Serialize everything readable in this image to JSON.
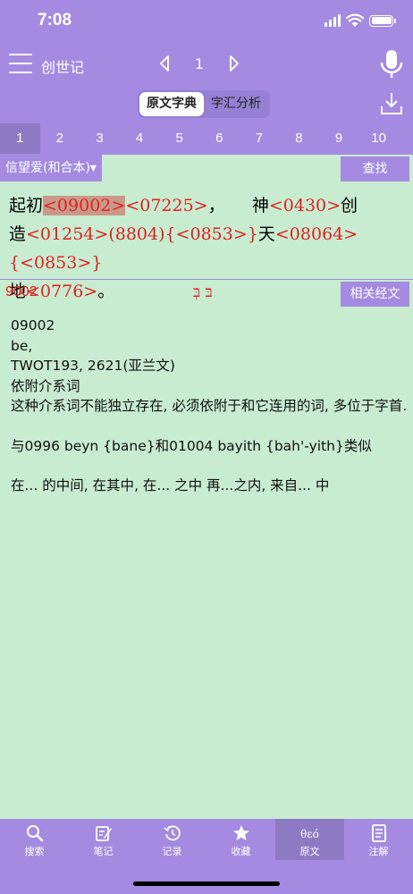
{
  "status": {
    "time": "7:08"
  },
  "nav": {
    "book": "创世记",
    "chapter": "1"
  },
  "segments": [
    {
      "label": "原文字典",
      "active": true
    },
    {
      "label": "字汇分析",
      "active": false
    }
  ],
  "verse_tabs": [
    "1",
    "2",
    "3",
    "4",
    "5",
    "6",
    "7",
    "8",
    "9",
    "10"
  ],
  "version": {
    "label": "信望爱(和合本)▾",
    "search_label": "查找"
  },
  "verse": {
    "t1": "起初",
    "r1": "<09002>",
    "r2": "<07225>",
    "t2": "，",
    "t3": "神",
    "r3": "<0430>",
    "t4": "创",
    "t5": "造",
    "r4": "<01254>",
    "r5": "(8804)",
    "r6": "{<0853>}",
    "t6": "天",
    "r7": "<08064>",
    "r8": "{<0853>}",
    "t7": "地",
    "r9": "<0776>",
    "t8": "。"
  },
  "word": {
    "number": "9002",
    "hebrew": "בּ בְּ",
    "related_label": "相关经文"
  },
  "definition": {
    "l1": "09002",
    "l2": "be,",
    "l3": "TWOT193, 2621(亚兰文)",
    "l4": "依附介系词",
    "l5": "这种介系词不能独立存在, 必须依附于和它连用的词, 多位于字首.",
    "l6": "与0996 beyn {bane}和01004 bayith {bah'-yith}类似",
    "l7": "在... 的中间, 在其中, 在... 之中 再...之内, 来自... 中"
  },
  "tabs": {
    "search": "搜索",
    "notes": "笔记",
    "history": "记录",
    "favorites": "收藏",
    "original_greek": "θεό",
    "original": "原文",
    "commentary": "注解"
  },
  "colors": {
    "accent": "#a48ae0",
    "accent_dark": "#8e7ac4",
    "content_bg": "#c8ecd0",
    "ref_red": "#e02020"
  }
}
